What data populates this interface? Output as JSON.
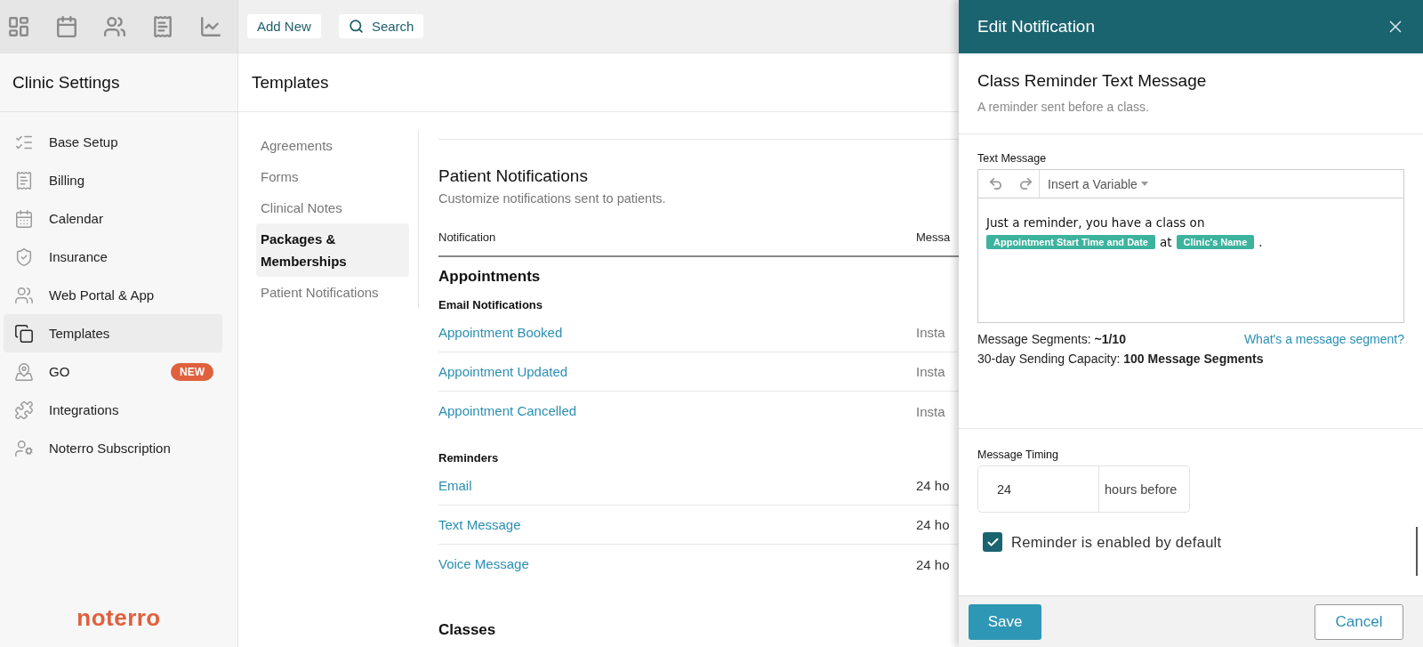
{
  "top_bar": {
    "buttons": [
      {
        "label": "Add New",
        "kind": "plain"
      },
      {
        "label": "Search",
        "kind": "search"
      }
    ]
  },
  "sidebar": {
    "title": "Clinic Settings",
    "items": [
      {
        "label": "Base Setup",
        "selected": false
      },
      {
        "label": "Billing",
        "selected": false
      },
      {
        "label": "Calendar",
        "selected": false
      },
      {
        "label": "Insurance",
        "selected": false
      },
      {
        "label": "Web Portal & App",
        "selected": false
      },
      {
        "label": "Templates",
        "selected": true
      },
      {
        "label": "GO",
        "selected": false,
        "badge": "NEW"
      },
      {
        "label": "Integrations",
        "selected": false
      },
      {
        "label": "Noterro Subscription",
        "selected": false
      }
    ],
    "logo": "noterro"
  },
  "page": {
    "title": "Templates",
    "subnav": [
      {
        "label": "Agreements",
        "selected": false
      },
      {
        "label": "Forms",
        "selected": false
      },
      {
        "label": "Clinical Notes",
        "selected": false
      },
      {
        "label": "Packages & Memberships",
        "selected": true
      },
      {
        "label": "Patient Notifications",
        "selected": false
      }
    ],
    "section": {
      "title": "Patient Notifications",
      "subtitle": "Customize notifications sent to patients.",
      "columns": [
        "Notification",
        "Messa"
      ],
      "groups": [
        {
          "title": "Appointments",
          "subgroups": [
            {
              "title": "Email Notifications",
              "rows": [
                {
                  "name": "Appointment Booked",
                  "timing": "Insta"
                },
                {
                  "name": "Appointment Updated",
                  "timing": "Insta"
                },
                {
                  "name": "Appointment Cancelled",
                  "timing": "Insta"
                }
              ]
            },
            {
              "title": "Reminders",
              "rows": [
                {
                  "name": "Email",
                  "timing": "24 ho"
                },
                {
                  "name": "Text Message",
                  "timing": "24 ho"
                },
                {
                  "name": "Voice Message",
                  "timing": "24 ho"
                }
              ]
            }
          ]
        },
        {
          "title": "Classes"
        }
      ]
    }
  },
  "panel": {
    "title": "Edit Notification",
    "notification_title": "Class Reminder Text Message",
    "description": "A reminder sent before a class.",
    "text_message": {
      "label": "Text Message",
      "insert_label": "Insert a Variable",
      "body": [
        {
          "kind": "text",
          "text": "Just a reminder, you have a class on"
        },
        {
          "kind": "break"
        },
        {
          "kind": "variable",
          "text": "Appointment Start Time and Date"
        },
        {
          "kind": "text",
          "text": "at"
        },
        {
          "kind": "variable",
          "text": "Clinic's Name"
        },
        {
          "kind": "text",
          "text": "."
        }
      ]
    },
    "segments": "Message Segments: **~1/10**",
    "segments_link": "What's a message segment?",
    "capacity": "30-day Sending Capacity: **100 Message Segments**",
    "timing": {
      "label": "Message Timing",
      "value": "24",
      "unit": "hours before"
    },
    "enabled": {
      "label": "Reminder is enabled by default",
      "checked": true
    },
    "buttons": [
      {
        "label": "Save",
        "kind": "primary"
      },
      {
        "label": "Cancel",
        "kind": "secondary"
      }
    ]
  }
}
